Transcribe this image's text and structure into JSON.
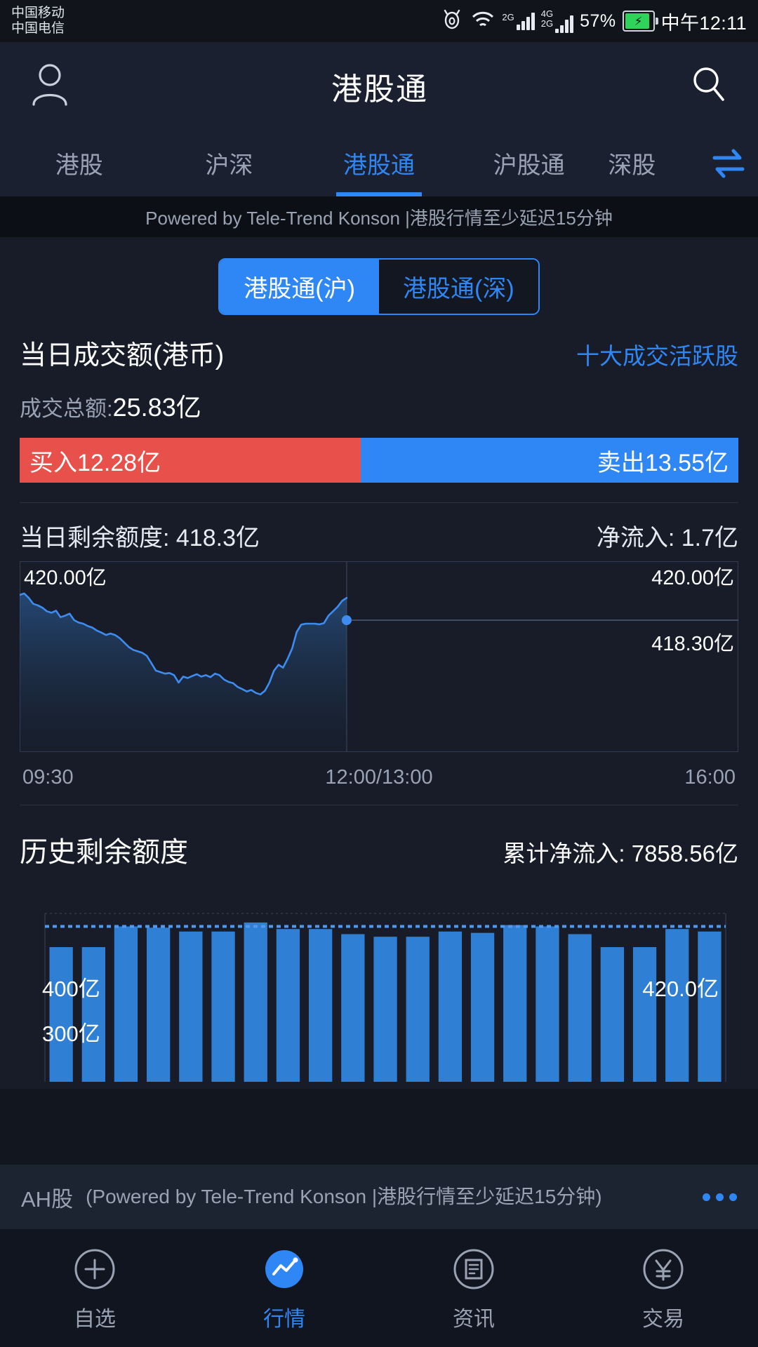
{
  "status_bar": {
    "carriers": [
      "中国移动",
      "中国电信"
    ],
    "signal_1_label": "2G",
    "signal_2_labels": [
      "4G",
      "2G"
    ],
    "battery_percent": "57%",
    "clock": "中午12:11",
    "icons": [
      "eye-icon",
      "wifi-icon",
      "signal-bars-icon",
      "battery-charging-icon"
    ]
  },
  "header": {
    "title": "港股通",
    "profile_icon": "person-icon",
    "search_icon": "search-icon"
  },
  "tabs": {
    "items": [
      {
        "label": "港股",
        "active": false
      },
      {
        "label": "沪深",
        "active": false
      },
      {
        "label": "港股通",
        "active": true
      },
      {
        "label": "沪股通",
        "active": false
      },
      {
        "label": "深股",
        "active": false
      }
    ],
    "swap_icon": "swap-arrows-icon"
  },
  "banner": {
    "text": "Powered by Tele-Trend Konson |港股行情至少延迟15分钟"
  },
  "segment": {
    "options": [
      {
        "label": "港股通(沪)",
        "active": true
      },
      {
        "label": "港股通(深)",
        "active": false
      }
    ]
  },
  "turnover": {
    "title": "当日成交额(港币)",
    "top_active_link": "十大成交活跃股",
    "total_label": "成交总额:",
    "total_value": "25.83亿",
    "buy_label": "买入12.28亿",
    "sell_label": "卖出13.55亿",
    "buy_color": "#e8514b",
    "sell_color": "#2f87f5",
    "buy_ratio": 0.475
  },
  "quota": {
    "remaining_label": "当日剩余额度: 418.3亿",
    "net_inflow_label": "净流入: 1.7亿"
  },
  "history": {
    "title": "历史剩余额度",
    "cumulative_label": "累计净流入: 7858.56亿"
  },
  "ah_bar": {
    "label": "AH股",
    "note": "(Powered by Tele-Trend Konson |港股行情至少延迟15分钟)",
    "more_icon": "more-dots-icon"
  },
  "bottom_nav": {
    "items": [
      {
        "label": "自选",
        "icon": "plus-circle-icon",
        "active": false
      },
      {
        "label": "行情",
        "icon": "trend-chart-icon",
        "active": true
      },
      {
        "label": "资讯",
        "icon": "news-document-icon",
        "active": false
      },
      {
        "label": "交易",
        "icon": "yuan-circle-icon",
        "active": false
      }
    ]
  },
  "chart_data": [
    {
      "type": "line",
      "name": "intraday-remaining-quota",
      "title": "当日剩余额度",
      "ylabel": "亿",
      "ylim": [
        414.0,
        420.0
      ],
      "axis_labels": {
        "top_left": "420.00亿",
        "top_right": "420.00亿",
        "current_right": "418.30亿"
      },
      "xlabel": "",
      "tick_labels": [
        "09:30",
        "12:00/13:00",
        "16:00"
      ],
      "current_value": 418.3,
      "grid": false,
      "legend": "none",
      "x": [
        0,
        1,
        2,
        3,
        4,
        5,
        6,
        7,
        8,
        9,
        10,
        11,
        12,
        13,
        14,
        15,
        16,
        17,
        18,
        19,
        20,
        21,
        22,
        23,
        24,
        25,
        26,
        27,
        28,
        29,
        30,
        31,
        32,
        33,
        34,
        35,
        36,
        37,
        38,
        39,
        40,
        41,
        42,
        43,
        44,
        45,
        46,
        47,
        48,
        49,
        50,
        51,
        52,
        53,
        54,
        55,
        56,
        57,
        58,
        59,
        60,
        61,
        62,
        63,
        64,
        65,
        66,
        67,
        68,
        69,
        70,
        71,
        72
      ],
      "values": [
        419.15,
        419.2,
        419.05,
        418.85,
        418.8,
        418.72,
        418.6,
        418.55,
        418.62,
        418.4,
        418.45,
        418.52,
        418.3,
        418.22,
        418.18,
        418.1,
        418.05,
        417.95,
        417.88,
        417.8,
        417.85,
        417.8,
        417.7,
        417.55,
        417.4,
        417.3,
        417.25,
        417.2,
        417.1,
        416.85,
        416.6,
        416.55,
        416.5,
        416.52,
        416.45,
        416.2,
        416.4,
        416.35,
        416.42,
        416.48,
        416.4,
        416.45,
        416.38,
        416.5,
        416.45,
        416.3,
        416.22,
        416.18,
        416.05,
        415.98,
        415.9,
        415.95,
        415.85,
        415.8,
        415.92,
        416.2,
        416.6,
        416.8,
        416.7,
        417.0,
        417.35,
        417.9,
        418.15,
        418.18,
        418.18,
        418.18,
        418.16,
        418.2,
        418.45,
        418.6,
        418.75,
        418.95,
        419.05
      ],
      "split_fraction": 0.455,
      "line_color": "#3f8cf0",
      "area_color": "#1d3category"
    },
    {
      "type": "bar",
      "name": "historical-remaining-quota",
      "title": "历史剩余额度",
      "ylabel": "亿",
      "ylim": [
        300,
        430
      ],
      "axis_labels": {
        "y_400": "400亿",
        "y_300": "300亿",
        "current_right": "420.0亿"
      },
      "reference_line": 420.0,
      "categories": [
        "1",
        "2",
        "3",
        "4",
        "5",
        "6",
        "7",
        "8",
        "9",
        "10",
        "11",
        "12",
        "13",
        "14",
        "15",
        "16",
        "17",
        "18",
        "19",
        "20",
        "21"
      ],
      "values": [
        404,
        404,
        420,
        419,
        416,
        416,
        423,
        418,
        418,
        414,
        412,
        412,
        416,
        415,
        421,
        420,
        414,
        404,
        404,
        418,
        416
      ],
      "bar_color": "#2f7fd4",
      "grid": false,
      "legend": "none"
    }
  ]
}
